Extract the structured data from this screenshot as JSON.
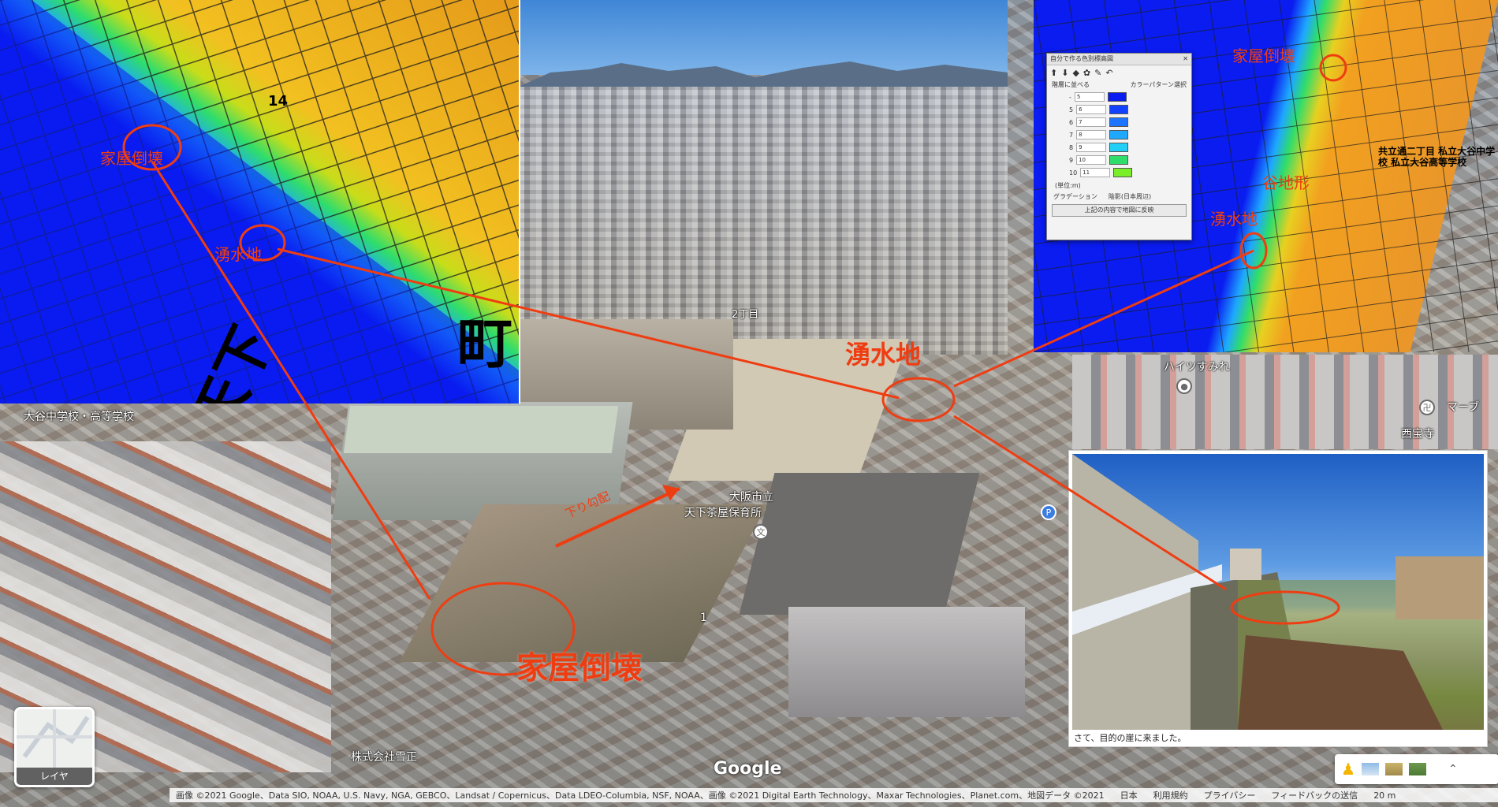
{
  "annotations": {
    "collapse_label_large": "家屋倒壊",
    "spring_label_large": "湧水地",
    "collapse_label_left": "家屋倒壊",
    "spring_label_left": "湧水地",
    "collapse_label_right": "家屋倒壊",
    "spring_label_right": "湧水地",
    "valley_label_right": "谷地形",
    "slope_label": "下り勾配"
  },
  "place_labels": {
    "school": "大谷中学校・高等学校",
    "nursery_line1": "大阪市立",
    "nursery_line2": "天下茶屋保育所",
    "chome2": "2丁目",
    "heights": "ハイツすみれ",
    "temple": "西宝寺",
    "marble": "マーブ",
    "company": "株式会社雪正",
    "numeral_1": "1",
    "right_map_school": "共立通二丁目 私立大谷中学校 私立大谷高等学校"
  },
  "left_map_text": {
    "road": "14",
    "large_char": "天下",
    "large_char2": "町"
  },
  "legend_dialog": {
    "title": "自分で作る色別標高図",
    "close": "✕",
    "tools": [
      "⬆",
      "⬇",
      "◆",
      "✿",
      "✎",
      "↶"
    ],
    "option_uniform": "階層に並べる",
    "color_pattern": "カラーパターン選択",
    "rows": [
      {
        "from": "-",
        "to": "5",
        "color": "#0a1cf0"
      },
      {
        "from": "5",
        "to": "6",
        "color": "#1242ff"
      },
      {
        "from": "6",
        "to": "7",
        "color": "#1c74ff"
      },
      {
        "from": "7",
        "to": "8",
        "color": "#1ea8ff"
      },
      {
        "from": "8",
        "to": "9",
        "color": "#22d0f7"
      },
      {
        "from": "9",
        "to": "10",
        "color": "#2fdd6b"
      },
      {
        "from": "10",
        "to": "11",
        "color": "#7bee2a"
      }
    ],
    "unit": "(単位:m)",
    "gradation": "グラデーション",
    "shading": "陰影(日本周辺)",
    "apply_button": "上記の内容で地図に反映"
  },
  "photo_inset": {
    "caption": "さて、目的の崖に来ました。"
  },
  "map_ui": {
    "layer_label": "レイヤ",
    "google_logo": "Google",
    "attribution": "画像 ©2021 Google、Data SIO, NOAA, U.S. Navy, NGA, GEBCO、Landsat / Copernicus、Data LDEO-Columbia, NSF, NOAA、画像 ©2021 Digital Earth Technology、Maxar Technologies、Planet.com、地図データ ©2021",
    "country": "日本",
    "terms": "利用規約",
    "privacy": "プライバシー",
    "feedback": "フィードバックの送信",
    "scale": "20 m"
  },
  "colors": {
    "annotation_red": "#ef3d12",
    "elevation_low": "#0a1cf0",
    "elevation_high": "#f2a020"
  }
}
